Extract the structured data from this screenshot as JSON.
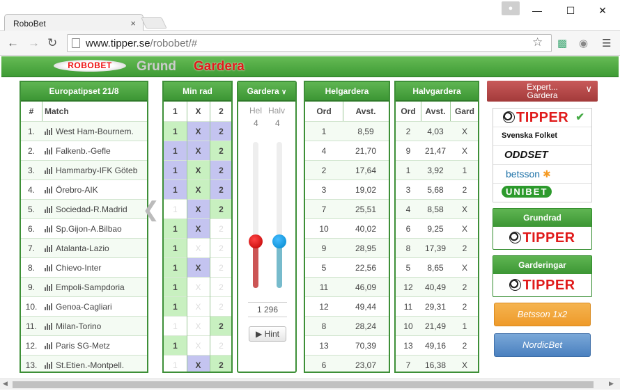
{
  "browser": {
    "tab_title": "RoboBet",
    "tab_close": "×",
    "url_host": "www.tipper.se",
    "url_path": "/robobet/#",
    "win_min": "—",
    "win_max": "☐",
    "win_close": "✕"
  },
  "site": {
    "logo": "ROBOBET",
    "nav_grund": "Grund",
    "nav_gardera": "Gardera",
    "accent_green": "#3e9b35",
    "accent_red": "#e01a1a"
  },
  "europatipset": {
    "title": "Europatipset 21/8",
    "col_num": "#",
    "col_match": "Match",
    "matches": [
      "West Ham-Bournem.",
      "Falkenb.-Gefle",
      "Hammarby-IFK Göteb",
      "Örebro-AIK",
      "Sociedad-R.Madrid",
      "Sp.Gijon-A.Bilbao",
      "Atalanta-Lazio",
      "Chievo-Inter",
      "Empoli-Sampdoria",
      "Genoa-Cagliari",
      "Milan-Torino",
      "Paris SG-Metz",
      "St.Etien.-Montpell."
    ],
    "numbers": [
      "1.",
      "2.",
      "3.",
      "4.",
      "5.",
      "6.",
      "7.",
      "8.",
      "9.",
      "10.",
      "11.",
      "12.",
      "13."
    ]
  },
  "minrad": {
    "title": "Min rad",
    "cols": [
      "1",
      "X",
      "2"
    ],
    "rows": [
      [
        "on",
        "on",
        "on"
      ],
      [
        "on",
        "on",
        "on"
      ],
      [
        "on",
        "on",
        "on"
      ],
      [
        "on",
        "on",
        "off2"
      ],
      [
        "off",
        "on",
        "on"
      ],
      [
        "on",
        "on",
        "off"
      ],
      [
        "on",
        "off",
        "off"
      ],
      [
        "on",
        "on",
        "off"
      ],
      [
        "on",
        "off",
        "off"
      ],
      [
        "on",
        "off",
        "off"
      ],
      [
        "off",
        "off",
        "on"
      ],
      [
        "on",
        "off",
        "off"
      ],
      [
        "off",
        "on",
        "on"
      ]
    ],
    "row_colors": [
      [
        "g",
        "b",
        "b"
      ],
      [
        "b",
        "b",
        "g"
      ],
      [
        "b",
        "g",
        "b"
      ],
      [
        "b",
        "g",
        "b"
      ],
      [
        "n",
        "b",
        "g"
      ],
      [
        "g",
        "b",
        "n"
      ],
      [
        "g",
        "n",
        "n"
      ],
      [
        "g",
        "b",
        "n"
      ],
      [
        "g",
        "n",
        "n"
      ],
      [
        "g",
        "n",
        "n"
      ],
      [
        "n",
        "n",
        "g"
      ],
      [
        "g",
        "n",
        "n"
      ],
      [
        "n",
        "b",
        "g"
      ]
    ]
  },
  "gardera": {
    "title": "Gardera",
    "hel_label": "Hel",
    "halv_label": "Halv",
    "hel_value": "4",
    "halv_value": "4",
    "total": "1 296",
    "hint": "Hint",
    "hel_level": 0.32,
    "halv_level": 0.32
  },
  "helgardera": {
    "title": "Helgardera",
    "col_ord": "Ord",
    "col_avst": "Avst.",
    "rows": [
      [
        "1",
        "8,59"
      ],
      [
        "4",
        "21,70"
      ],
      [
        "2",
        "17,64"
      ],
      [
        "3",
        "19,02"
      ],
      [
        "7",
        "25,51"
      ],
      [
        "10",
        "40,02"
      ],
      [
        "9",
        "28,95"
      ],
      [
        "5",
        "22,56"
      ],
      [
        "11",
        "46,09"
      ],
      [
        "12",
        "49,44"
      ],
      [
        "8",
        "28,24"
      ],
      [
        "13",
        "70,39"
      ],
      [
        "6",
        "23,07"
      ]
    ]
  },
  "halvgardera": {
    "title": "Halvgardera",
    "col_ord": "Ord",
    "col_avst": "Avst.",
    "col_gard": "Gard",
    "rows": [
      [
        "2",
        "4,03",
        "X"
      ],
      [
        "9",
        "21,47",
        "X"
      ],
      [
        "1",
        "3,92",
        "1"
      ],
      [
        "3",
        "5,68",
        "2"
      ],
      [
        "4",
        "8,58",
        "X"
      ],
      [
        "6",
        "9,25",
        "X"
      ],
      [
        "8",
        "17,39",
        "2"
      ],
      [
        "5",
        "8,65",
        "X"
      ],
      [
        "12",
        "40,49",
        "2"
      ],
      [
        "11",
        "29,31",
        "2"
      ],
      [
        "10",
        "21,49",
        "1"
      ],
      [
        "13",
        "49,16",
        "2"
      ],
      [
        "7",
        "16,38",
        "X"
      ]
    ]
  },
  "sidebar": {
    "expert_label": "Expert...",
    "expert_sub": "Gardera",
    "sources": [
      "TIPPER",
      "Svenska Folket",
      "ODDSET",
      "betsson",
      "UNIBET"
    ],
    "grundrad_title": "Grundrad",
    "grundrad_logo": "TIPPER",
    "garderingar_title": "Garderingar",
    "garderingar_logo": "TIPPER",
    "betsson_btn": "Betsson 1x2",
    "nordicbet_btn": "NordicBet"
  }
}
